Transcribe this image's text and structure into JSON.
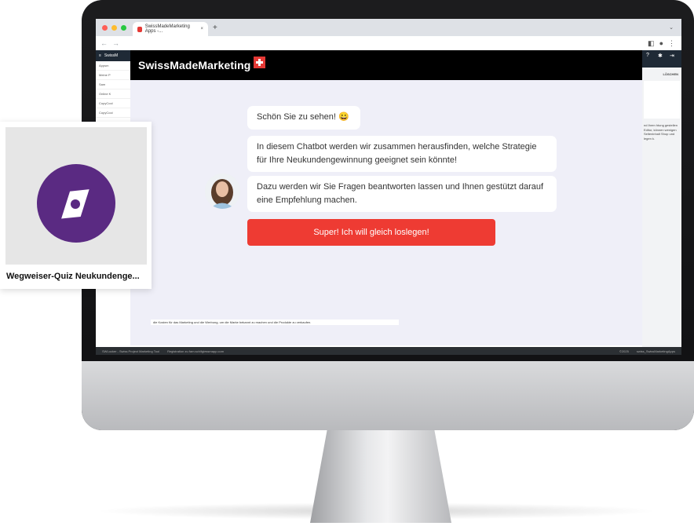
{
  "browser": {
    "tab_title": "SwissMadeMarketing Apps -...",
    "tab_close": "×",
    "new_tab": "+"
  },
  "brand": {
    "name": "SwissMadeMarketing",
    "accent": "#e53935",
    "header_bg": "#000000"
  },
  "chat": {
    "messages": [
      {
        "text": "Schön Sie zu sehen! 😀"
      },
      {
        "text": "In diesem Chatbot werden wir zusammen herausfinden, welche Strategie für Ihre Neukundengewinnung geeignet sein könnte!"
      },
      {
        "text": "Dazu werden wir Sie Fragen beantworten lassen und Ihnen gestützt darauf eine Empfehlung machen."
      }
    ],
    "cta_label": "Super! Ich will gleich loslegen!",
    "cta_color": "#ee3b33",
    "background": "#efeff8"
  },
  "app_left": {
    "header": "SwissM",
    "items": [
      "Appsm",
      "Meine P",
      "Sam",
      "Online K",
      "CopyCool",
      "CopyCool"
    ]
  },
  "app_right": {
    "delete_label": "LÖSCHEN",
    "text": "nd Ihren htung gestellen Editor, können wenigen Seiteninhalt Shop und legen k."
  },
  "statusbar": {
    "left": "SWLocker - Swiss Project Marketing Tool",
    "center": "Registration zu fam.sch/fgiessmapp.com",
    "right_a": "©2025",
    "right_b": "swiss_SwissMarketingApps"
  },
  "bottom_text": "die Kosten für das Marketing und die Werbung, um die Marke bekannt zu machen und die Produkte zu verkaufen.",
  "quiz_card": {
    "title": "Wegweiser-Quiz Neukundenge...",
    "icon_color": "#5a2a82"
  }
}
